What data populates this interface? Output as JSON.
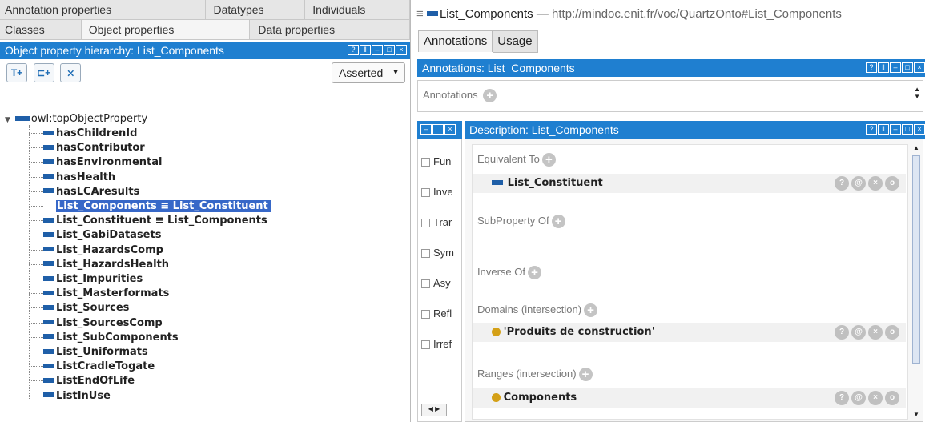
{
  "left": {
    "tabs_row1": [
      "Annotation properties",
      "Datatypes",
      "Individuals"
    ],
    "tabs_row2": [
      "Classes",
      "Object properties",
      "Data properties"
    ],
    "view_title": "Object property hierarchy: List_Components",
    "asserted_label": "Asserted",
    "root": "owl:topObjectProperty",
    "items": [
      "hasChildrenId",
      "hasContributor",
      "hasEnvironmental",
      "hasHealth",
      "hasLCAresults",
      "List_Components ≡ List_Constituent",
      "List_Constituent ≡ List_Components",
      "List_GabiDatasets",
      "List_HazardsComp",
      "List_HazardsHealth",
      "List_Impurities",
      "List_Masterformats",
      "List_Sources",
      "List_SourcesComp",
      "List_SubComponents",
      "List_Uniformats",
      "ListCradleTogate",
      "ListEndOfLife",
      "ListInUse"
    ],
    "selected_index": 5
  },
  "right": {
    "header_entity": "List_Components",
    "header_sep": "—",
    "header_iri": "http://mindoc.enit.fr/voc/QuartzOnto#List_Components",
    "tabs": [
      "Annotations",
      "Usage"
    ],
    "annotations_view_title": "Annotations: List_Components",
    "annotations_label": "Annotations",
    "characteristics": [
      "Fun",
      "Inve",
      "Trar",
      "Sym",
      "Asy",
      "Refl",
      "Irref"
    ],
    "description_title": "Description: List_Components",
    "sections": {
      "equivalent_to": "Equivalent To",
      "equivalent_value": "List_Constituent",
      "subproperty_of": "SubProperty Of",
      "inverse_of": "Inverse Of",
      "domains": "Domains (intersection)",
      "domain_value": "'Produits de construction'",
      "ranges": "Ranges (intersection)",
      "range_value": "Components"
    },
    "entity_color": "#1f5fa8",
    "class_color": "#d4a017"
  }
}
